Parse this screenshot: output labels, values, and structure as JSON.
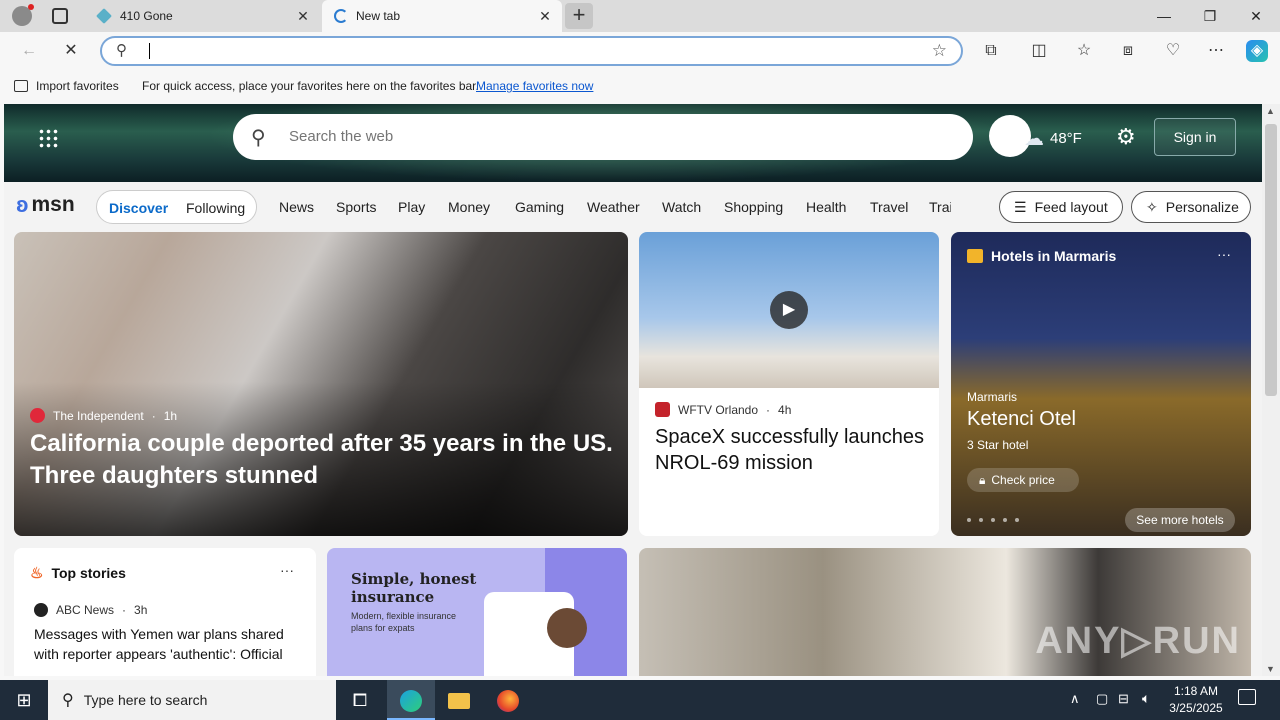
{
  "browser": {
    "tabs": [
      {
        "title": "410 Gone"
      },
      {
        "title": "New tab"
      }
    ],
    "window_controls": [
      "minimize",
      "restore",
      "close"
    ],
    "address_bar": {
      "value": ""
    },
    "favorites_bar": {
      "import_label": "Import favorites",
      "message": "For quick access, place your favorites here on the favorites bar.",
      "link": "Manage favorites now"
    }
  },
  "msn": {
    "search_placeholder": "Search the web",
    "weather": {
      "temp": "48°F"
    },
    "sign_in": "Sign in",
    "logo": "msn",
    "tabs": {
      "discover": "Discover",
      "following": "Following"
    },
    "nav": [
      "News",
      "Sports",
      "Play",
      "Money",
      "Gaming",
      "Weather",
      "Watch",
      "Shopping",
      "Health",
      "Travel",
      "Trai"
    ],
    "feed_layout": "Feed layout",
    "personalize": "Personalize",
    "cards": {
      "main": {
        "source": "The Independent",
        "time": "1h",
        "title": "California couple deported after 35 years in the US. Three daughters stunned"
      },
      "spacex": {
        "source": "WFTV Orlando",
        "time": "4h",
        "title": "SpaceX successfully launches NROL-69 mission"
      },
      "hotels": {
        "heading": "Hotels in Marmaris",
        "location": "Marmaris",
        "name": "Ketenci Otel",
        "stars": "3 Star hotel",
        "check": "Check price",
        "see_more": "See more hotels"
      },
      "top": {
        "heading": "Top stories",
        "source": "ABC News",
        "time": "3h",
        "title": "Messages with Yemen war plans shared with reporter appears 'authentic': Official"
      },
      "ad": {
        "heading": "Simple, honest insurance",
        "sub": "Modern, flexible insurance plans for expats"
      }
    }
  },
  "taskbar": {
    "search_placeholder": "Type here to search",
    "time": "1:18 AM",
    "date": "3/25/2025"
  }
}
